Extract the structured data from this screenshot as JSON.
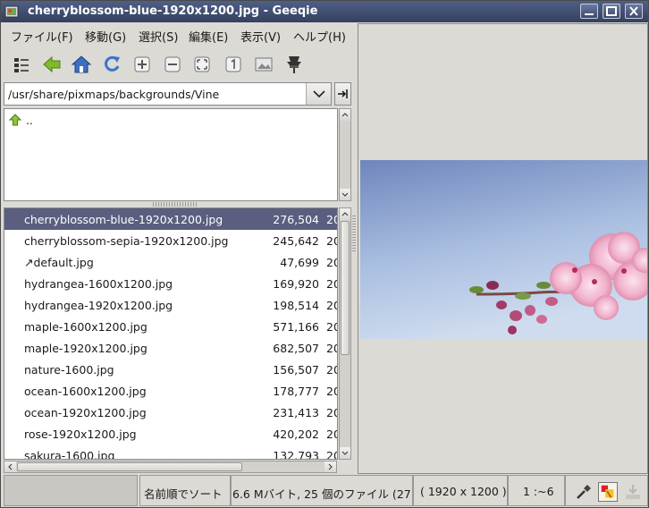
{
  "window": {
    "title": "cherryblossom-blue-1920x1200.jpg - Geeqie"
  },
  "menu": [
    "ファイル(F)",
    "移動(G)",
    "選択(S)",
    "編集(E)",
    "表示(V)",
    "ヘルプ(H)"
  ],
  "toolbar": {
    "icons": [
      "thumbnails-icon",
      "back-icon",
      "home-icon",
      "refresh-icon",
      "zoom-in-icon",
      "zoom-out-icon",
      "zoom-fit-icon",
      "zoom-1-1-icon",
      "settings-icon",
      "float-icon"
    ]
  },
  "path": {
    "value": "/usr/share/pixmaps/backgrounds/Vine"
  },
  "dirs": [
    {
      "name": ".."
    }
  ],
  "files": [
    {
      "name": "cherryblossom-blue-1920x1200.jpg",
      "size": "276,504",
      "date": "20",
      "selected": true
    },
    {
      "name": "cherryblossom-sepia-1920x1200.jpg",
      "size": "245,642",
      "date": "20"
    },
    {
      "name": "↗default.jpg",
      "size": "47,699",
      "date": "20"
    },
    {
      "name": "hydrangea-1600x1200.jpg",
      "size": "169,920",
      "date": "20"
    },
    {
      "name": "hydrangea-1920x1200.jpg",
      "size": "198,514",
      "date": "20"
    },
    {
      "name": "maple-1600x1200.jpg",
      "size": "571,166",
      "date": "20"
    },
    {
      "name": "maple-1920x1200.jpg",
      "size": "682,507",
      "date": "20"
    },
    {
      "name": "nature-1600.jpg",
      "size": "156,507",
      "date": "20"
    },
    {
      "name": "ocean-1600x1200.jpg",
      "size": "178,777",
      "date": "20"
    },
    {
      "name": "ocean-1920x1200.jpg",
      "size": "231,413",
      "date": "20"
    },
    {
      "name": "rose-1920x1200.jpg",
      "size": "420,202",
      "date": "20"
    },
    {
      "name": "sakura-1600.jpg",
      "size": "132,793",
      "date": "20"
    }
  ],
  "status": {
    "sort": "名前順でソート",
    "summary": "6.6 Mバイト, 25 個のファイル (27",
    "dimensions": "( 1920 x 1200 ) 2",
    "zoom": "1 :~6"
  }
}
